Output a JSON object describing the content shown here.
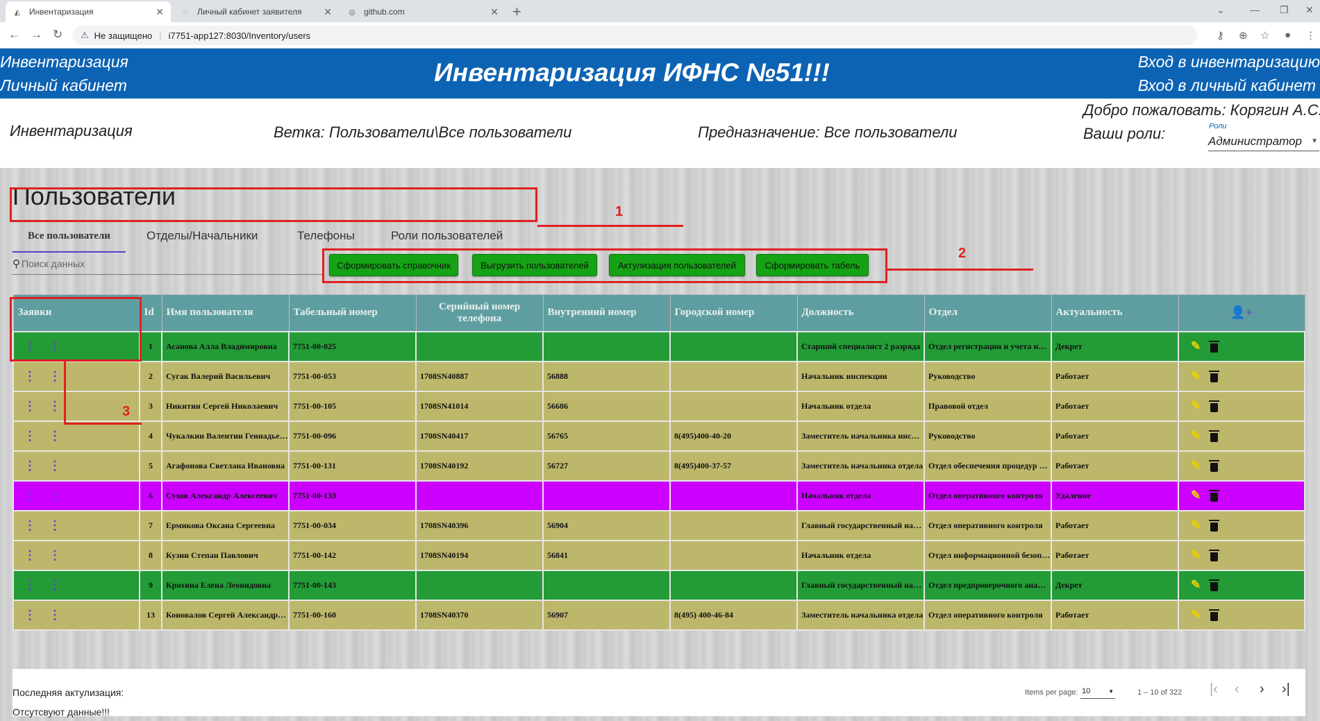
{
  "browser": {
    "tabs": [
      {
        "title": "Инвентаризация",
        "icon": "app-icon"
      },
      {
        "title": "Личный кабинет заявителя",
        "icon": "page-icon"
      },
      {
        "title": "github.com",
        "icon": "globe-icon"
      }
    ],
    "security_warning": "Не защищено",
    "url": "i7751-app127:8030/Inventory/users"
  },
  "header": {
    "left_links": [
      "Инвентаризация",
      "Личный кабинет"
    ],
    "title": "Инвентаризация ИФНС №51!!!",
    "right_links": [
      "Вход в инвентаризацию",
      "Вход в личный кабинет"
    ]
  },
  "infobar": {
    "section": "Инвентаризация",
    "branch": "Ветка: Пользователи\\Все пользователи",
    "purpose": "Предназначение: Все пользователи",
    "welcome": "Добро пожаловать: Корягин А.С.",
    "roles_label": "Ваши роли:",
    "roles_field_label": "Роли",
    "roles_value": "Администратор"
  },
  "page": {
    "title": "Пользователи",
    "tabs": [
      "Все пользователи",
      "Отделы/Начальники",
      "Телефоны",
      "Роли пользователей"
    ],
    "search_placeholder": "Поиск данных",
    "buttons": [
      "Сформировать справочник",
      "Выгрузить пользователей",
      "Актулизация пользователей",
      "Сформировать табель"
    ]
  },
  "table": {
    "columns": [
      "Заявки",
      "Id",
      "Имя пользователя",
      "Табельный номер",
      "Серийный номер телефона",
      "Внутренний номер",
      "Городской номер",
      "Должность",
      "Отдел",
      "Актуальность"
    ],
    "rows": [
      {
        "id": "1",
        "name": "Асанова Алла Владимировна",
        "tab": "7751-00-025",
        "serial": "",
        "internal": "",
        "city": "",
        "position": "Старший специалист 2 разряда",
        "dept": "Отдел регистрации и учета налогоплательщиков",
        "status": "Декрет"
      },
      {
        "id": "2",
        "name": "Сугак Валерий Васильевич",
        "tab": "7751-00-053",
        "serial": "1708SN40887",
        "internal": "56888",
        "city": "",
        "position": "Начальник инспекции",
        "dept": "Руководство",
        "status": "Работает"
      },
      {
        "id": "3",
        "name": "Никитин Сергей Николаевич",
        "tab": "7751-00-105",
        "serial": "1708SN41014",
        "internal": "56686",
        "city": "",
        "position": "Начальник отдела",
        "dept": "Правовой отдел",
        "status": "Работает"
      },
      {
        "id": "4",
        "name": "Чукалкин Валентин Геннадьевич",
        "tab": "7751-00-096",
        "serial": "1708SN40417",
        "internal": "56765",
        "city": "8(495)400-40-20",
        "position": "Заместитель начальника инспекции",
        "dept": "Руководство",
        "status": "Работает"
      },
      {
        "id": "5",
        "name": "Агафонова Светлана Ивановна",
        "tab": "7751-00-131",
        "serial": "1708SN40192",
        "internal": "56727",
        "city": "8(495)400-37-57",
        "position": "Заместитель начальника отдела",
        "dept": "Отдел обеспечения процедур банкротства",
        "status": "Работает"
      },
      {
        "id": "6",
        "name": "Сухов Александр Алексеевич",
        "tab": "7751-00-133",
        "serial": "",
        "internal": "",
        "city": "",
        "position": "Начальник отдела",
        "dept": "Отдел оперативного контроля",
        "status": "Удаление"
      },
      {
        "id": "7",
        "name": "Ермикова Оксана Сергеевна",
        "tab": "7751-00-034",
        "serial": "1708SN40396",
        "internal": "56904",
        "city": "",
        "position": "Главный государственный налоговый инспектор",
        "dept": "Отдел оперативного контроля",
        "status": "Работает"
      },
      {
        "id": "8",
        "name": "Кузин Степан Павлович",
        "tab": "7751-00-142",
        "serial": "1708SN40194",
        "internal": "56841",
        "city": "",
        "position": "Начальник отдела",
        "dept": "Отдел информационной безопасности",
        "status": "Работает"
      },
      {
        "id": "9",
        "name": "Крохина Елена Леонидовна",
        "tab": "7751-00-143",
        "serial": "",
        "internal": "",
        "city": "",
        "position": "Главный государственный налоговый инспектор",
        "dept": "Отдел предпроверочного анализа",
        "status": "Декрет"
      },
      {
        "id": "13",
        "name": "Коновалов Сергей Александрович",
        "tab": "7751-00-160",
        "serial": "1708SN40370",
        "internal": "56907",
        "city": "8(495) 400-46-84",
        "position": "Заместитель начальника отдела",
        "dept": "Отдел оперативного контроля",
        "status": "Работает"
      }
    ]
  },
  "pager": {
    "items_label": "Items per page:",
    "page_size": "10",
    "range": "1 – 10 of 322"
  },
  "footer": {
    "last_update": "Последняя актулизация:",
    "no_data": "Отсутсвуют данные!!!"
  },
  "annotations": [
    "1",
    "2",
    "3"
  ],
  "colors": {
    "header_blue": "#0d63b3",
    "table_header": "#5f9ea0",
    "status_working": "#bdb76b",
    "status_decree": "#239b36",
    "status_deleted": "#cc00ff",
    "button_green": "#15a315",
    "annotation_red": "#e02020"
  }
}
